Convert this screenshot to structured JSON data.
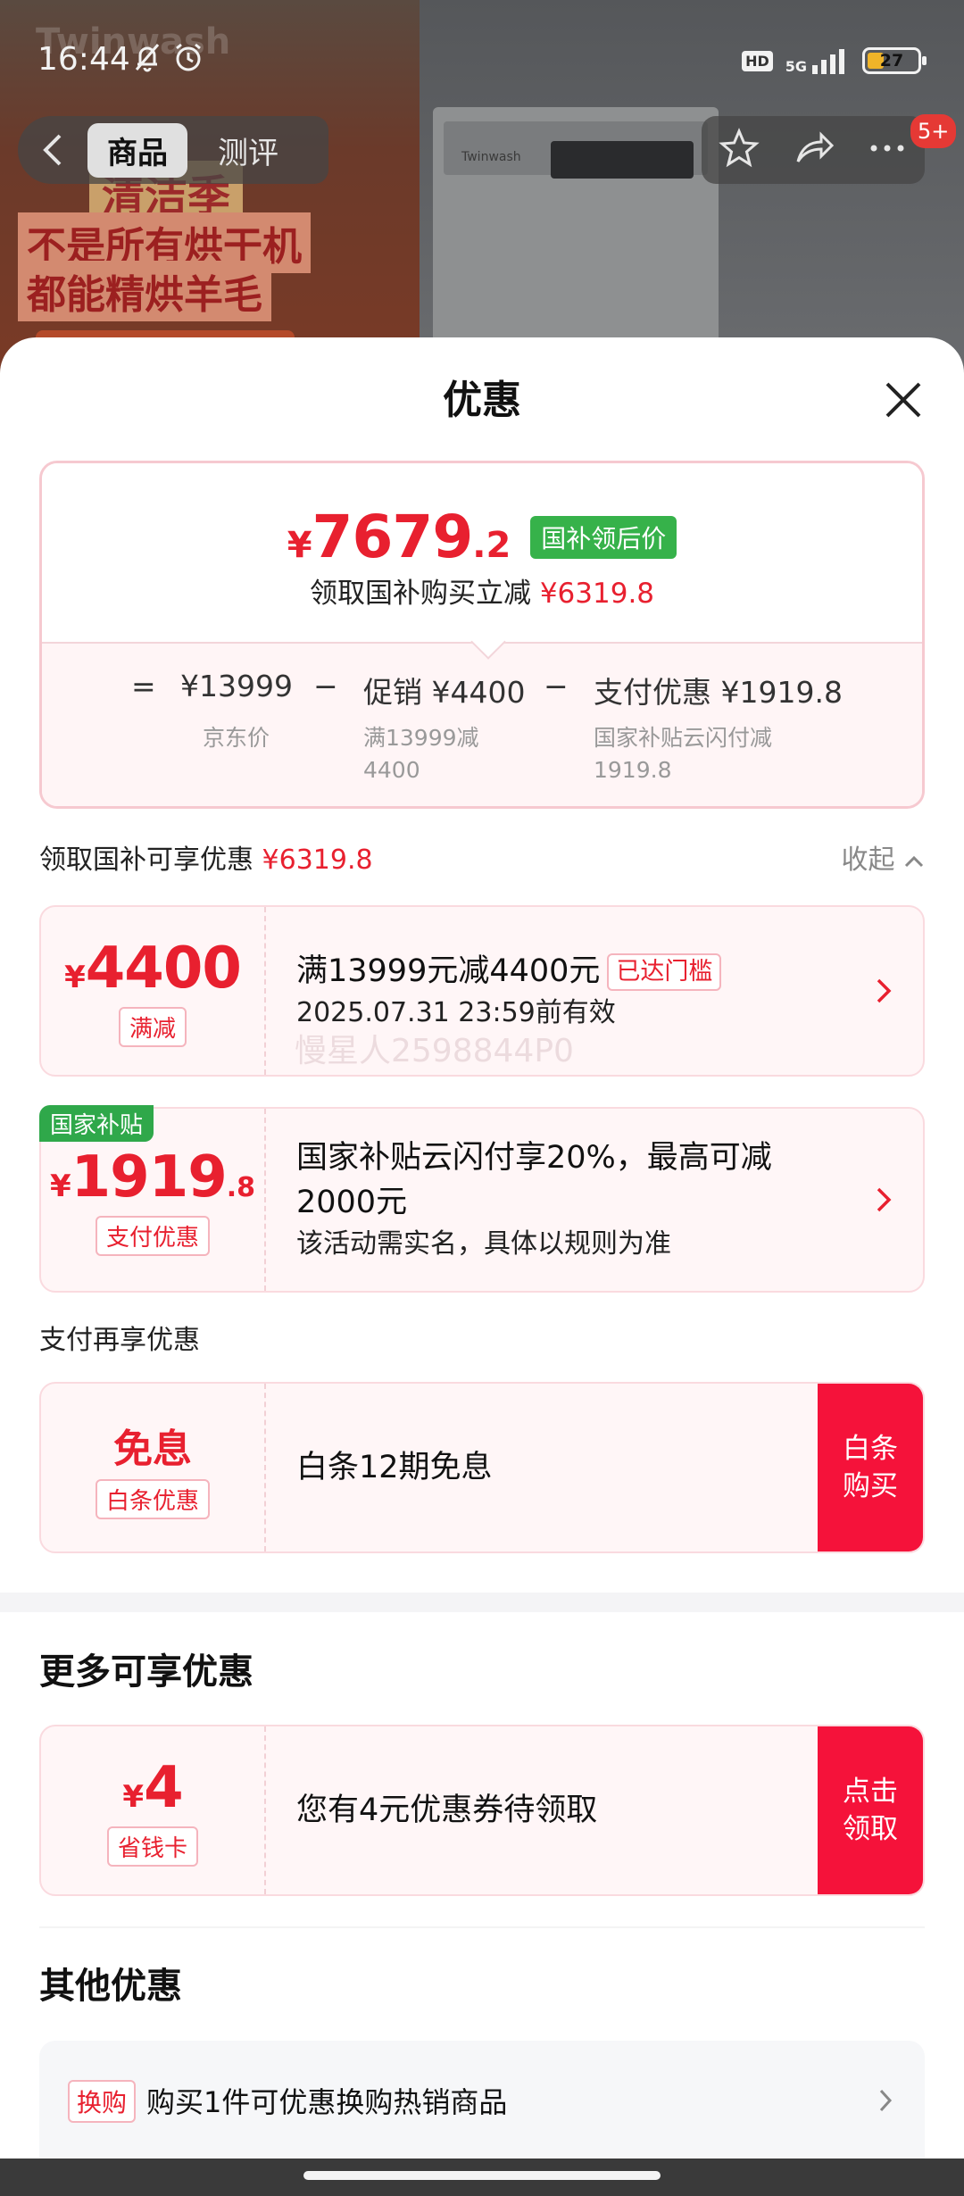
{
  "background": {
    "brand_ghost": "Twinwash",
    "washer_brand": "Twinwash",
    "banner_line1": "清洁季",
    "banner_line2": "不是所有烘干机",
    "banner_line3": "都能精烘羊毛"
  },
  "status_bar": {
    "time": "16:44",
    "network": "5G",
    "hd_label": "HD",
    "battery": "27"
  },
  "nav": {
    "tabs": [
      {
        "label": "商品",
        "active": true
      },
      {
        "label": "测评",
        "active": false
      }
    ],
    "badge": "5+"
  },
  "sheet": {
    "title": "优惠"
  },
  "price_summary": {
    "currency": "¥",
    "final_int": "7679",
    "final_dec": ".2",
    "final_tag": "国补领后价",
    "sub_text": "领取国补购买立减",
    "sub_amount": "¥6319.8",
    "equals": "=",
    "minus": "−",
    "jd_price": "¥13999",
    "jd_label": "京东价",
    "promo": "促销 ¥4400",
    "promo_label_1": "满13999减",
    "promo_label_2": "4400",
    "pay": "支付优惠 ¥1919.8",
    "pay_label_1": "国家补贴云闪付减",
    "pay_label_2": "1919.8"
  },
  "section_guobu": {
    "label": "领取国补可享优惠",
    "amount": "¥6319.8",
    "collapse": "收起"
  },
  "card_promo": {
    "currency": "¥",
    "amount": "4400",
    "tag": "满减",
    "title": "满13999元减4400元",
    "badge": "已达门槛",
    "valid": "2025.07.31 23:59前有效"
  },
  "watermark": "慢星人2598844P0",
  "card_subsidy": {
    "corner_tag": "国家补贴",
    "currency": "¥",
    "amount_int": "1919",
    "amount_dec": ".8",
    "tag": "支付优惠",
    "title_1": "国家补贴云闪付享20%，最高可减",
    "title_2": "2000元",
    "sub": "该活动需实名，具体以规则为准"
  },
  "section_pay": {
    "label": "支付再享优惠"
  },
  "card_baitiao": {
    "word": "免息",
    "tag": "白条优惠",
    "title": "白条12期免息",
    "cta_1": "白条",
    "cta_2": "购买"
  },
  "section_more": {
    "title": "更多可享优惠"
  },
  "card_coupon": {
    "currency": "¥",
    "amount": "4",
    "tag": "省钱卡",
    "title": "您有4元优惠券待领取",
    "cta_1": "点击",
    "cta_2": "领取"
  },
  "section_other": {
    "title": "其他优惠"
  },
  "other_item": {
    "tag": "换购",
    "text": "购买1件可优惠换购热销商品"
  },
  "colors": {
    "accent_red": "#e8202f",
    "cta_red": "#f5123a",
    "subsidy_green": "#36b24a"
  }
}
